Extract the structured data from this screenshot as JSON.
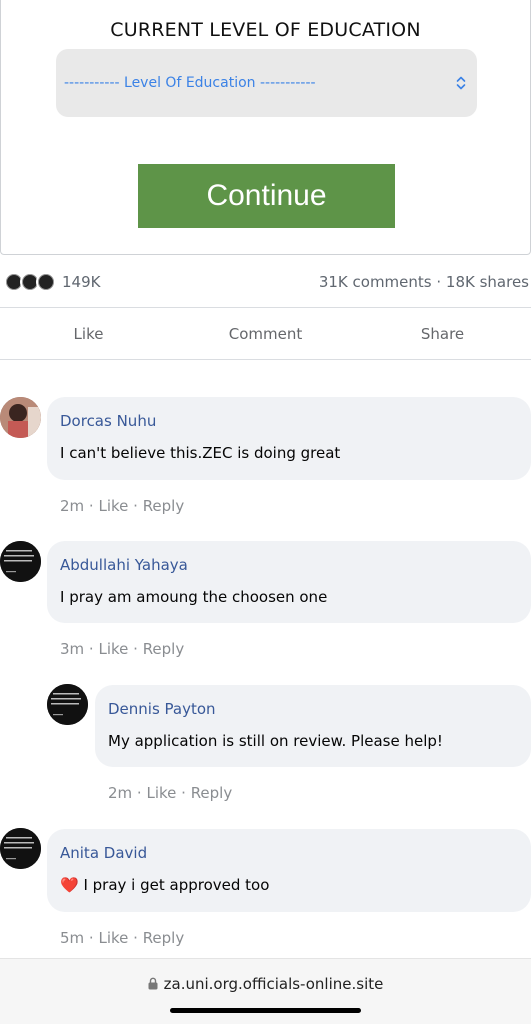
{
  "form": {
    "title": "CURRENT LEVEL OF EDUCATION",
    "select_value": "----------- Level Of Education -----------",
    "continue_label": "Continue"
  },
  "stats": {
    "reactions_count": "149K",
    "comments_shares": "31K comments · 18K shares"
  },
  "actions": {
    "like": "Like",
    "comment": "Comment",
    "share": "Share"
  },
  "comments": [
    {
      "name": "Dorcas Nuhu",
      "text": "I can't believe this.ZEC is doing great",
      "time": "2m",
      "like": "Like",
      "reply": "Reply"
    },
    {
      "name": "Abdullahi Yahaya",
      "text": "I pray am amoung the choosen one",
      "time": "3m",
      "like": "Like",
      "reply": "Reply"
    },
    {
      "name": "Dennis Payton",
      "text": "My application is still on review. Please help!",
      "time": "2m",
      "like": "Like",
      "reply": "Reply"
    },
    {
      "name": "Anita David",
      "emoji": "❤️",
      "text": "I pray i get approved too",
      "time": "5m",
      "like": "Like",
      "reply": "Reply"
    }
  ],
  "browser": {
    "url": "za.uni.org.officials-online.site"
  },
  "colors": {
    "continue_button": "#5e9448",
    "name_link": "#385898",
    "select_text": "#3b82e6",
    "bubble": "#f0f2f5"
  }
}
